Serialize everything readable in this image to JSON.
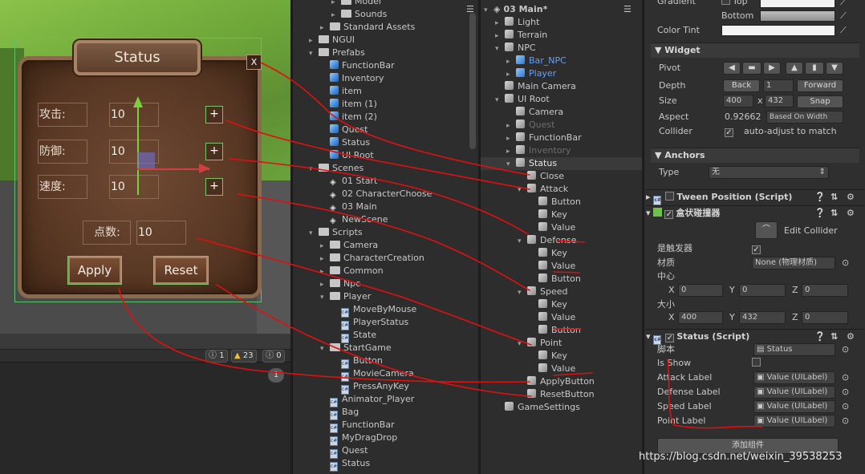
{
  "scene_view": {
    "panel_title": "Status",
    "close_label": "X",
    "stats": [
      {
        "label": "攻击:",
        "value": "10",
        "plus": "+"
      },
      {
        "label": "防御:",
        "value": "10",
        "plus": "+"
      },
      {
        "label": "速度:",
        "value": "10",
        "plus": "+"
      }
    ],
    "points_label": "点数:",
    "points_value": "10",
    "apply_label": "Apply",
    "reset_label": "Reset"
  },
  "console": {
    "counts": [
      "1",
      "23",
      "0"
    ],
    "bubble": "1"
  },
  "project": {
    "rows": [
      {
        "indent": 3,
        "type": "folder",
        "arrow": "▸",
        "label": "Model",
        "partial": true
      },
      {
        "indent": 3,
        "type": "folder",
        "arrow": "▸",
        "label": "Sounds"
      },
      {
        "indent": 2,
        "type": "folder",
        "arrow": "▸",
        "label": "Standard Assets"
      },
      {
        "indent": 1,
        "type": "folder",
        "arrow": "▸",
        "label": "NGUI"
      },
      {
        "indent": 1,
        "type": "folder",
        "arrow": "▾",
        "label": "Prefabs"
      },
      {
        "indent": 2,
        "type": "prefab",
        "arrow": "",
        "label": "FunctionBar"
      },
      {
        "indent": 2,
        "type": "prefab",
        "arrow": "",
        "label": "Inventory"
      },
      {
        "indent": 2,
        "type": "prefab",
        "arrow": "",
        "label": "item"
      },
      {
        "indent": 2,
        "type": "prefab",
        "arrow": "",
        "label": "item (1)"
      },
      {
        "indent": 2,
        "type": "prefab",
        "arrow": "",
        "label": "item (2)"
      },
      {
        "indent": 2,
        "type": "prefab",
        "arrow": "",
        "label": "Quest"
      },
      {
        "indent": 2,
        "type": "prefab",
        "arrow": "",
        "label": "Status"
      },
      {
        "indent": 2,
        "type": "prefab",
        "arrow": "",
        "label": "UI Root"
      },
      {
        "indent": 1,
        "type": "folder",
        "arrow": "▾",
        "label": "Scenes"
      },
      {
        "indent": 2,
        "type": "scene",
        "arrow": "",
        "label": "01 Start"
      },
      {
        "indent": 2,
        "type": "scene",
        "arrow": "",
        "label": "02 CharacterChoose"
      },
      {
        "indent": 2,
        "type": "scene",
        "arrow": "",
        "label": "03 Main"
      },
      {
        "indent": 2,
        "type": "scene",
        "arrow": "",
        "label": "NewScene"
      },
      {
        "indent": 1,
        "type": "folder",
        "arrow": "▾",
        "label": "Scripts"
      },
      {
        "indent": 2,
        "type": "folder",
        "arrow": "▸",
        "label": "Camera"
      },
      {
        "indent": 2,
        "type": "folder",
        "arrow": "▸",
        "label": "CharacterCreation"
      },
      {
        "indent": 2,
        "type": "folder",
        "arrow": "▸",
        "label": "Common"
      },
      {
        "indent": 2,
        "type": "folder",
        "arrow": "▸",
        "label": "Npc"
      },
      {
        "indent": 2,
        "type": "folder",
        "arrow": "▾",
        "label": "Player"
      },
      {
        "indent": 3,
        "type": "script",
        "arrow": "",
        "label": "MoveByMouse"
      },
      {
        "indent": 3,
        "type": "script",
        "arrow": "",
        "label": "PlayerStatus"
      },
      {
        "indent": 3,
        "type": "script",
        "arrow": "",
        "label": "State"
      },
      {
        "indent": 2,
        "type": "folder",
        "arrow": "▾",
        "label": "StartGame"
      },
      {
        "indent": 3,
        "type": "script",
        "arrow": "",
        "label": "Button"
      },
      {
        "indent": 3,
        "type": "script",
        "arrow": "",
        "label": "MovieCamera"
      },
      {
        "indent": 3,
        "type": "script",
        "arrow": "",
        "label": "PressAnyKey"
      },
      {
        "indent": 2,
        "type": "script",
        "arrow": "",
        "label": "Animator_Player"
      },
      {
        "indent": 2,
        "type": "script",
        "arrow": "",
        "label": "Bag"
      },
      {
        "indent": 2,
        "type": "script",
        "arrow": "",
        "label": "FunctionBar"
      },
      {
        "indent": 2,
        "type": "script",
        "arrow": "",
        "label": "MyDragDrop"
      },
      {
        "indent": 2,
        "type": "script",
        "arrow": "",
        "label": "Quest"
      },
      {
        "indent": 2,
        "type": "script",
        "arrow": "",
        "label": "Status"
      }
    ]
  },
  "hierarchy": {
    "scene_title": "03 Main*",
    "rows": [
      {
        "indent": 1,
        "arrow": "▸",
        "label": "Light",
        "style": "normal"
      },
      {
        "indent": 1,
        "arrow": "▸",
        "label": "Terrain",
        "style": "normal"
      },
      {
        "indent": 1,
        "arrow": "▾",
        "label": "NPC",
        "style": "normal"
      },
      {
        "indent": 2,
        "arrow": "▸",
        "label": "Bar_NPC",
        "style": "blue"
      },
      {
        "indent": 2,
        "arrow": "▸",
        "label": "Player",
        "style": "blue"
      },
      {
        "indent": 1,
        "arrow": "",
        "label": "Main Camera",
        "style": "normal"
      },
      {
        "indent": 1,
        "arrow": "▾",
        "label": "UI Root",
        "style": "normal"
      },
      {
        "indent": 2,
        "arrow": "",
        "label": "Camera",
        "style": "normal"
      },
      {
        "indent": 2,
        "arrow": "▸",
        "label": "Quest",
        "style": "dim"
      },
      {
        "indent": 2,
        "arrow": "▸",
        "label": "FunctionBar",
        "style": "normal"
      },
      {
        "indent": 2,
        "arrow": "▸",
        "label": "Inventory",
        "style": "dim"
      },
      {
        "indent": 2,
        "arrow": "▾",
        "label": "Status",
        "style": "selected"
      },
      {
        "indent": 3,
        "arrow": "",
        "label": "Close",
        "style": "normal"
      },
      {
        "indent": 3,
        "arrow": "▾",
        "label": "Attack",
        "style": "normal"
      },
      {
        "indent": 4,
        "arrow": "",
        "label": "Button",
        "style": "normal"
      },
      {
        "indent": 4,
        "arrow": "",
        "label": "Key",
        "style": "normal"
      },
      {
        "indent": 4,
        "arrow": "",
        "label": "Value",
        "style": "normal"
      },
      {
        "indent": 3,
        "arrow": "▾",
        "label": "Defense",
        "style": "normal"
      },
      {
        "indent": 4,
        "arrow": "",
        "label": "Key",
        "style": "normal"
      },
      {
        "indent": 4,
        "arrow": "",
        "label": "Value",
        "style": "normal"
      },
      {
        "indent": 4,
        "arrow": "",
        "label": "Button",
        "style": "normal"
      },
      {
        "indent": 3,
        "arrow": "▾",
        "label": "Speed",
        "style": "normal"
      },
      {
        "indent": 4,
        "arrow": "",
        "label": "Key",
        "style": "normal"
      },
      {
        "indent": 4,
        "arrow": "",
        "label": "Value",
        "style": "normal"
      },
      {
        "indent": 4,
        "arrow": "",
        "label": "Button",
        "style": "normal"
      },
      {
        "indent": 3,
        "arrow": "▾",
        "label": "Point",
        "style": "normal"
      },
      {
        "indent": 4,
        "arrow": "",
        "label": "Key",
        "style": "normal"
      },
      {
        "indent": 4,
        "arrow": "",
        "label": "Value",
        "style": "normal"
      },
      {
        "indent": 3,
        "arrow": "",
        "label": "ApplyButton",
        "style": "normal"
      },
      {
        "indent": 3,
        "arrow": "",
        "label": "ResetButton",
        "style": "normal"
      },
      {
        "indent": 1,
        "arrow": "",
        "label": "GameSettings",
        "style": "normal"
      }
    ]
  },
  "inspector": {
    "gradient_label": "Gradient",
    "top_label": "Top",
    "bottom_label": "Bottom",
    "color_tint_label": "Color Tint",
    "widget": {
      "title": "Widget",
      "pivot_label": "Pivot",
      "depth_label": "Depth",
      "back_label": "Back",
      "depth_value": "1",
      "forward_label": "Forward",
      "size_label": "Size",
      "size_w": "400",
      "size_x": "x",
      "size_h": "432",
      "snap_label": "Snap",
      "aspect_label": "Aspect",
      "aspect_value": "0.92662",
      "aspect_mode": "Based On Width",
      "collider_label": "Collider",
      "collider_text": "auto-adjust to match"
    },
    "anchors": {
      "title": "Anchors",
      "type_label": "Type",
      "type_value": "无"
    },
    "tween": {
      "title": "Tween Position (Script)"
    },
    "box_collider": {
      "title": "盒状碰撞器",
      "edit_label": "Edit Collider",
      "trigger_label": "是触发器",
      "material_label": "材质",
      "material_value": "None (物理材质)",
      "center_label": "中心",
      "size_label": "大小",
      "center": {
        "x": "0",
        "y": "0",
        "z": "0"
      },
      "size": {
        "x": "400",
        "y": "432",
        "z": "0"
      },
      "axis_x": "X",
      "axis_y": "Y",
      "axis_z": "Z"
    },
    "status_script": {
      "title": "Status (Script)",
      "script_label": "脚本",
      "script_value": "Status",
      "is_show_label": "Is Show",
      "fields": [
        {
          "label": "Attack Label",
          "value": "Value (UILabel)"
        },
        {
          "label": "Defense Label",
          "value": "Value (UILabel)"
        },
        {
          "label": "Speed Label",
          "value": "Value (UILabel)"
        },
        {
          "label": "Point Label",
          "value": "Value (UILabel)"
        }
      ]
    },
    "add_component_label": "添加组件"
  },
  "watermark": "https://blog.csdn.net/weixin_39538253",
  "colors": {
    "annotation_red": "#e01010",
    "selection_green": "#59c46a",
    "prefab_blue": "#5fa0ff"
  }
}
